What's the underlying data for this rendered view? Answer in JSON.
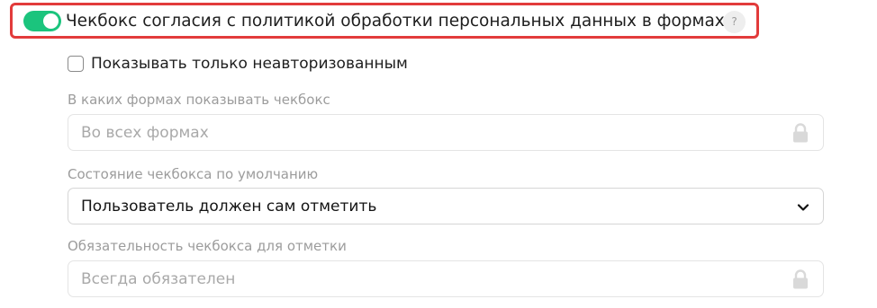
{
  "consent": {
    "toggle_on": true,
    "label": "Чекбокс согласия с политикой обработки персональных данных в формах",
    "help": "?",
    "accent": "#1bc47d",
    "highlight": "#e23b3b"
  },
  "unauth_only": {
    "checked": false,
    "label": "Показывать только неавторизованным"
  },
  "forms_field": {
    "label": "В каких формах показывать чекбокс",
    "value": "Во всех формах",
    "icon": "lock-icon"
  },
  "default_state_field": {
    "label": "Состояние чекбокса по умолчанию",
    "value": "Пользователь должен сам отметить",
    "icon": "chevron-down-icon"
  },
  "required_field": {
    "label": "Обязательность чекбокса для отметки",
    "value": "Всегда обязателен",
    "icon": "lock-icon"
  }
}
